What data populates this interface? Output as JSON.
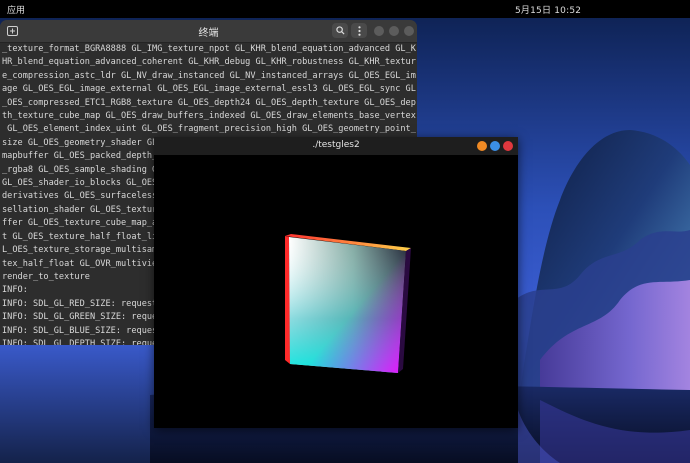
{
  "topbar": {
    "apps_label": "应用",
    "clock": "5月15日  10:52"
  },
  "terminal": {
    "title": "终端",
    "lines": [
      "_texture_format_BGRA8888 GL_IMG_texture_npot GL_KHR_blend_equation_advanced GL_K",
      "HR_blend_equation_advanced_coherent GL_KHR_debug GL_KHR_robustness GL_KHR_textur",
      "e_compression_astc_ldr GL_NV_draw_instanced GL_NV_instanced_arrays GL_OES_EGL_im",
      "age GL_OES_EGL_image_external GL_OES_EGL_image_external_essl3 GL_OES_EGL_sync GL",
      "_OES_compressed_ETC1_RGB8_texture GL_OES_depth24 GL_OES_depth_texture GL_OES_dep",
      "th_texture_cube_map GL_OES_draw_buffers_indexed GL_OES_draw_elements_base_vertex",
      " GL_OES_element_index_uint GL_OES_fragment_precision_high GL_OES_geometry_point_",
      "size GL_OES_geometry_shader GL_OES_get_program_binary GL_OES_gpu_shader5 GL_OES_",
      "mapbuffer GL_OES_packed_depth_",
      "_rgba8 GL_OES_sample_shading G",
      "GL_OES_shader_io_blocks GL_OES",
      "derivatives GL_OES_surfaceless",
      "sellation_shader GL_OES_textur",
      "ffer GL_OES_texture_cube_map_a",
      "t GL_OES_texture_half_float_li",
      "L_OES_texture_storage_multisam",
      "tex_half_float GL_OVR_multiview",
      "render_to_texture",
      "INFO:",
      "INFO: SDL_GL_RED_SIZE: request",
      "INFO: SDL_GL_GREEN_SIZE: reque",
      "INFO: SDL_GL_BLUE_SIZE: reques",
      "INFO: SDL_GL_DEPTH_SIZE: reque"
    ]
  },
  "app_window": {
    "title": "./testgles2",
    "button_colors": [
      "#f08a24",
      "#3b8fe6",
      "#e0383e"
    ]
  },
  "icons": {
    "search": "search-icon",
    "menu": "kebab-menu-icon",
    "new_tab": "new-tab-icon"
  }
}
